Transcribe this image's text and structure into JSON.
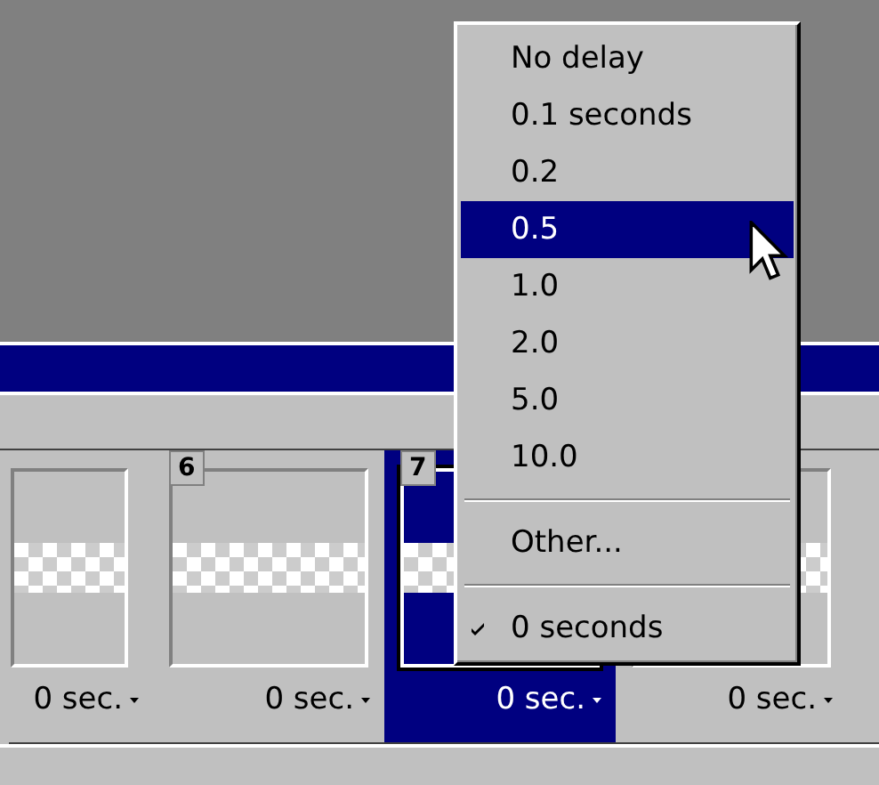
{
  "frames": [
    {
      "selected": false,
      "delay": "0 sec."
    },
    {
      "number": "6",
      "selected": false,
      "delay": "0 sec."
    },
    {
      "number": "7",
      "selected": true,
      "delay": "0 sec."
    },
    {
      "selected": false,
      "delay": "0 sec."
    }
  ],
  "delay_menu": {
    "items": [
      {
        "kind": "item",
        "label": "No delay",
        "selected": false,
        "checked": false
      },
      {
        "kind": "item",
        "label": "0.1 seconds",
        "selected": false,
        "checked": false
      },
      {
        "kind": "item",
        "label": "0.2",
        "selected": false,
        "checked": false
      },
      {
        "kind": "item",
        "label": "0.5",
        "selected": true,
        "checked": false
      },
      {
        "kind": "item",
        "label": "1.0",
        "selected": false,
        "checked": false
      },
      {
        "kind": "item",
        "label": "2.0",
        "selected": false,
        "checked": false
      },
      {
        "kind": "item",
        "label": "5.0",
        "selected": false,
        "checked": false
      },
      {
        "kind": "item",
        "label": "10.0",
        "selected": false,
        "checked": false
      },
      {
        "kind": "separator"
      },
      {
        "kind": "item",
        "label": "Other...",
        "selected": false,
        "checked": false
      },
      {
        "kind": "separator"
      },
      {
        "kind": "item",
        "label": "0 seconds",
        "selected": false,
        "checked": true
      }
    ]
  }
}
